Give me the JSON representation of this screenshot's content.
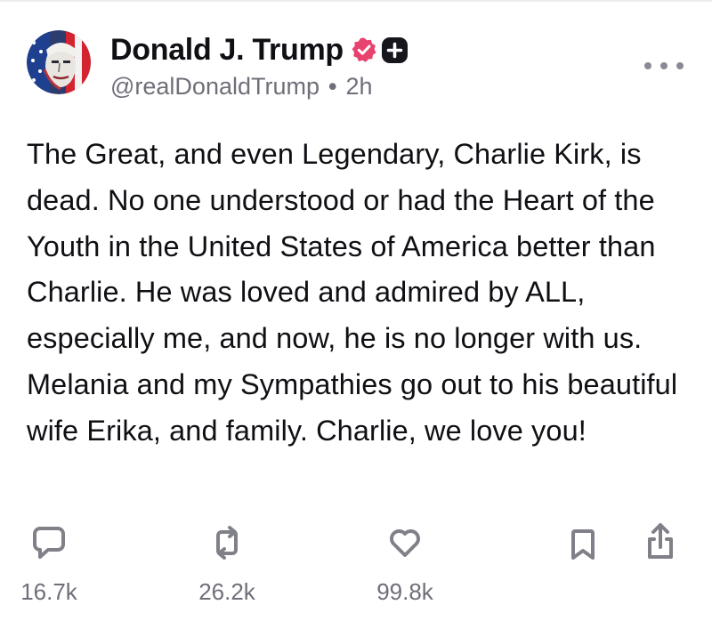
{
  "post": {
    "author": {
      "display_name": "Donald J. Trump",
      "handle": "@realDonaldTrump",
      "verified_icon": "verified-check-icon",
      "badge_icon": "plus-badge-icon",
      "verified_color": "#e8426e"
    },
    "separator": "•",
    "time_ago": "2h",
    "text": "The Great, and even Legendary, Charlie Kirk, is dead. No one understood or had the Heart of the Youth in the United States of America better than Charlie. He was loved and admired by ALL, especially me, and now, he is no longer with us. Melania and my Sympathies go out to his beautiful wife Erika, and family. Charlie, we love you!",
    "actions": {
      "reply": {
        "icon": "reply-icon",
        "count": "16.7k"
      },
      "repost": {
        "icon": "repost-icon",
        "count": "26.2k"
      },
      "like": {
        "icon": "heart-icon",
        "count": "99.8k"
      },
      "bookmark": {
        "icon": "bookmark-icon"
      },
      "share": {
        "icon": "share-icon"
      }
    },
    "more_icon": "more-dots-icon"
  },
  "colors": {
    "text": "#0f0f14",
    "muted": "#6f6f7a",
    "icon": "#808089"
  }
}
